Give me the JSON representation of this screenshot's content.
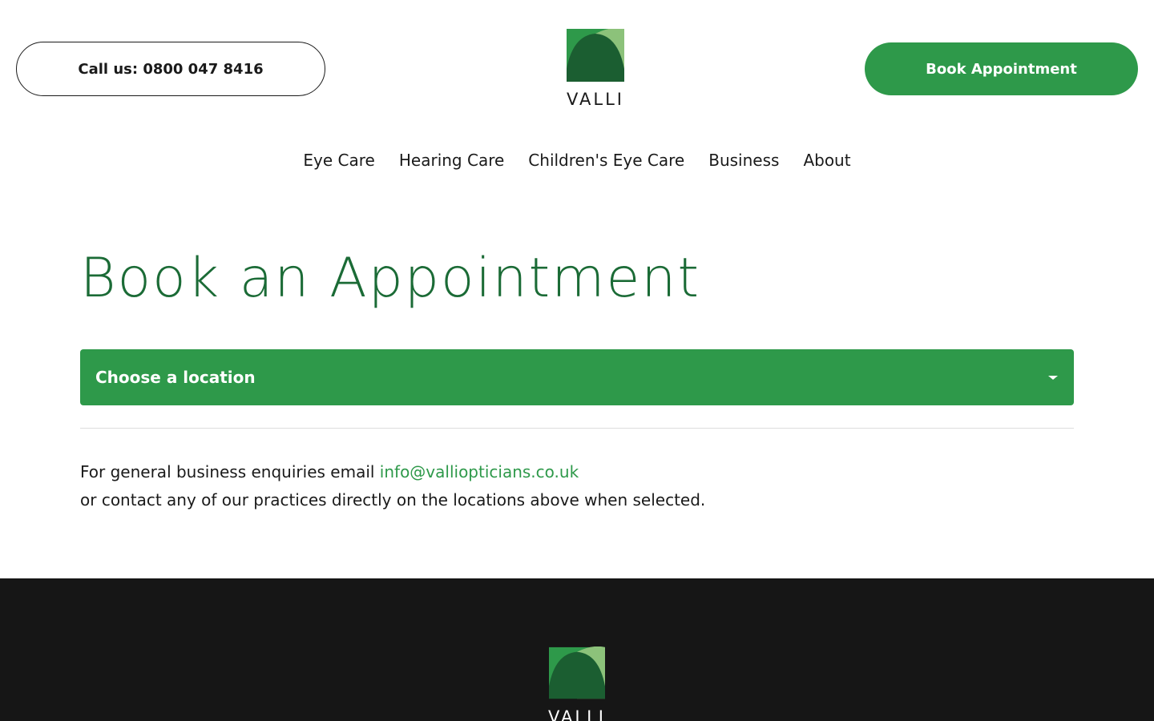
{
  "header": {
    "call_label": "Call us: 0800 047 8416",
    "book_label": "Book Appointment",
    "logo_text": "VALLI"
  },
  "nav": {
    "items": [
      {
        "label": "Eye Care"
      },
      {
        "label": "Hearing Care"
      },
      {
        "label": "Children's Eye Care"
      },
      {
        "label": "Business"
      },
      {
        "label": "About"
      }
    ]
  },
  "main": {
    "title": "Book an Appointment",
    "location_select": {
      "selected": "Choose a location",
      "icon": "chevron-down-icon"
    },
    "info_line1_prefix": "For general business enquiries email ",
    "info_email": "info@valliopticians.co.uk",
    "info_line2": "or contact any of our practices directly on the locations above when selected."
  },
  "footer": {
    "logo_text": "VALLI"
  },
  "colors": {
    "brand_green": "#2e994a",
    "title_green": "#1b6b36",
    "footer_bg": "#161616",
    "logo_dark": "#1b5e31",
    "logo_light": "#8cc27a"
  }
}
